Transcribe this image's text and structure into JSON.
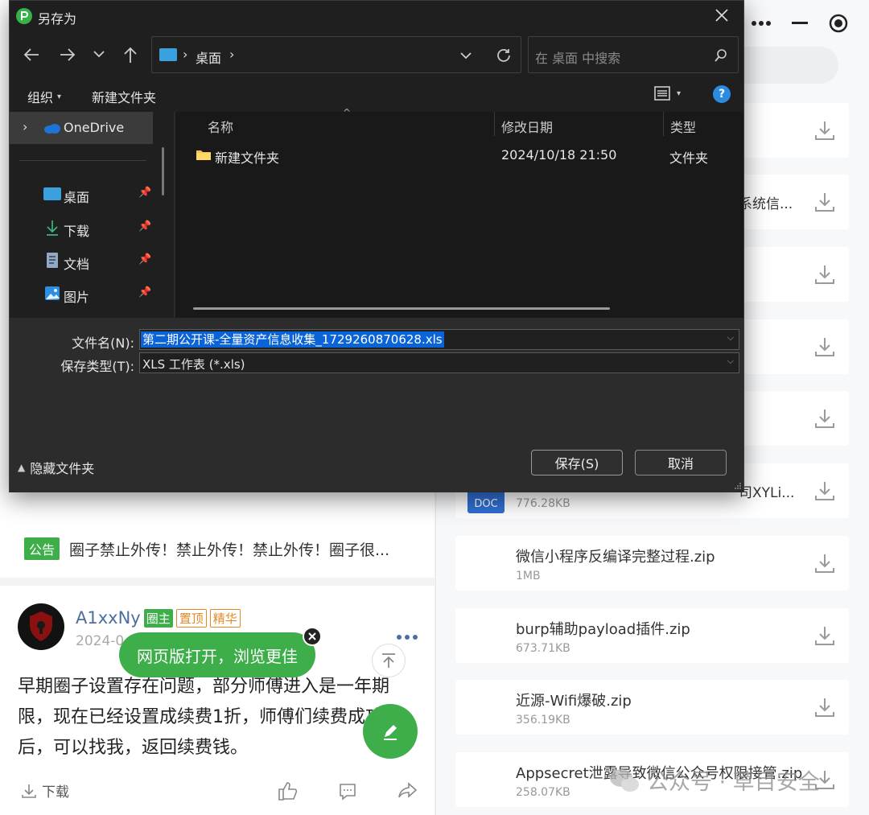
{
  "dialog": {
    "title": "另存为",
    "address": {
      "location": "桌面"
    },
    "search_placeholder": "在 桌面 中搜索",
    "toolbar": {
      "organize": "组织",
      "new_folder": "新建文件夹"
    },
    "sidebar": {
      "onedrive": "OneDrive",
      "items": [
        {
          "label": "桌面",
          "icon": "desktop-icon"
        },
        {
          "label": "下载",
          "icon": "download-icon"
        },
        {
          "label": "文档",
          "icon": "document-icon"
        },
        {
          "label": "图片",
          "icon": "picture-icon"
        }
      ]
    },
    "columns": {
      "name": "名称",
      "date": "修改日期",
      "type": "类型"
    },
    "files": [
      {
        "name": "新建文件夹",
        "date": "2024/10/18 21:50",
        "type": "文件夹"
      }
    ],
    "filename_label": "文件名(N):",
    "filename_value": "第二期公开课-全量资产信息收集_1729260870628.xls",
    "filetype_label": "保存类型(T):",
    "filetype_value": "XLS 工作表 (*.xls)",
    "hide_folders": "隐藏文件夹",
    "save_button": "保存(S)",
    "cancel_button": "取消",
    "colors": {
      "accent": "#0067c0",
      "selection": "#0a64d8"
    }
  },
  "right_list": {
    "files": [
      {
        "name": "系统信...",
        "size": ""
      },
      {
        "name": "司XYLi...",
        "size": "776.28KB",
        "badge": "DOC"
      },
      {
        "name": "微信小程序反编译完整过程.zip",
        "size": "1MB"
      },
      {
        "name": "burp辅助payload插件.zip",
        "size": "673.71KB"
      },
      {
        "name": "近源-Wifi爆破.zip",
        "size": "356.19KB"
      },
      {
        "name": "Appsecret泄露导致微信公众号权限接管.zip",
        "size": "258.07KB"
      }
    ]
  },
  "left_feed": {
    "notice_tag": "公告",
    "notice_text": "圈子禁止外传！禁止外传！禁止外传！圈子很...",
    "post": {
      "author": "A1xxNy",
      "badges": [
        "圈主",
        "置顶",
        "精华"
      ],
      "date_partial": "2024-0",
      "body": "早期圈子设置存在问题，部分师傅进入是一年期限，现在已经设置成续费1折，师傅们续费成功后，可以找我，返回续费钱。",
      "download_label": "下载"
    },
    "toast": "网页版打开，浏览更佳"
  },
  "watermark": "公众号 · 草目安全",
  "colors": {
    "brand_green": "#3dae4a",
    "badge_orange": "#e48a25"
  }
}
